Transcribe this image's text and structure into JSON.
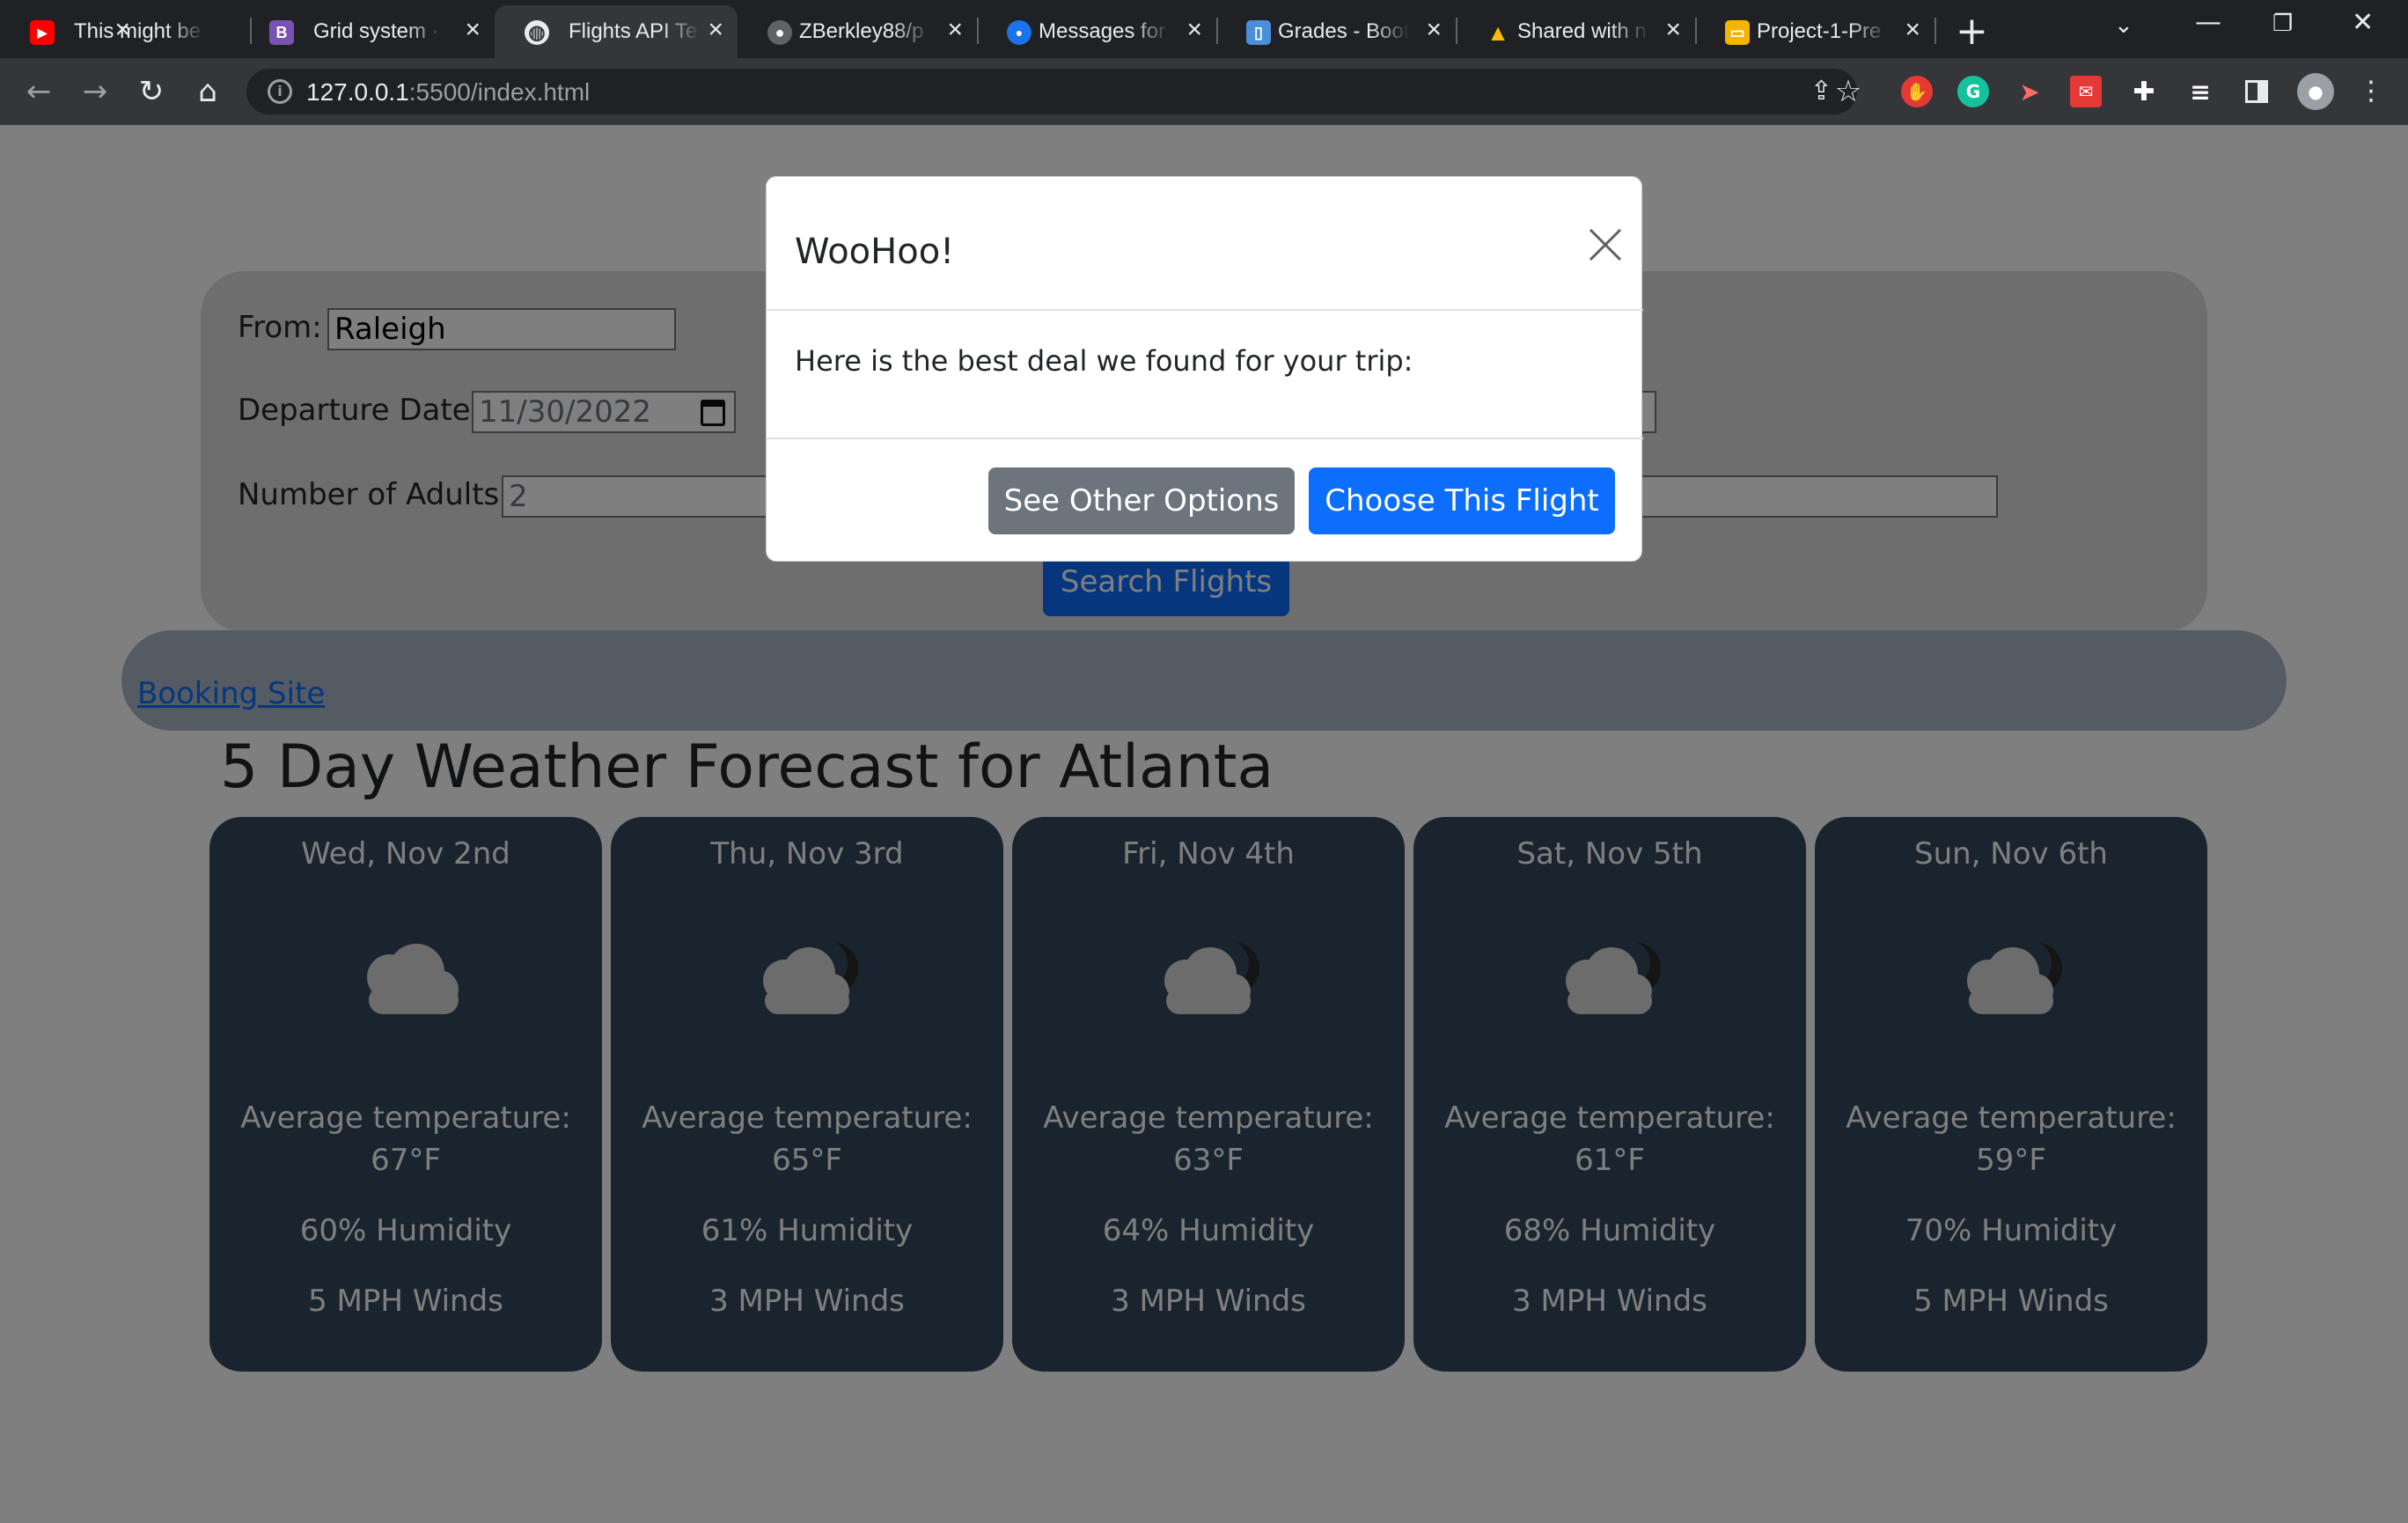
{
  "browser": {
    "tabs": [
      {
        "title": "This might be",
        "favicon": "youtube-icon",
        "color": "#ff0000",
        "glyph": "▶"
      },
      {
        "title": "Grid system ·",
        "favicon": "bootstrap-icon",
        "color": "#7952b3",
        "glyph": "B"
      },
      {
        "title": "Flights API Te",
        "favicon": "globe-icon",
        "color": "#35363a",
        "glyph": "◍"
      },
      {
        "title": "ZBerkley88/p",
        "favicon": "github-icon",
        "color": "#202124",
        "glyph": "●"
      },
      {
        "title": "Messages for",
        "favicon": "messages-icon",
        "color": "#1a73e8",
        "glyph": "●"
      },
      {
        "title": "Grades - Boot",
        "favicon": "grades-icon",
        "color": "#4a90d9",
        "glyph": "▯"
      },
      {
        "title": "Shared with n",
        "favicon": "drive-icon",
        "color": "#1fa463",
        "glyph": "▲"
      },
      {
        "title": "Project-1-Pre",
        "favicon": "slides-icon",
        "color": "#f4b400",
        "glyph": "▭"
      }
    ],
    "url_host": "127.0.0.1",
    "url_rest": ":5500/index.html"
  },
  "page": {
    "title_fragment": "",
    "form": {
      "from_label": "From:",
      "from_value": "Raleigh",
      "departure_label": "Departure Date:",
      "departure_value": "11/30/2022",
      "adults_label": "Number of Adults:",
      "adults_value": "2",
      "search_button": "Search Flights"
    },
    "booking_link": "Booking Site",
    "forecast_title": "5 Day Weather Forecast for Atlanta",
    "forecast": [
      {
        "date": "Wed, Nov 2nd",
        "temp_label": "Average temperature:",
        "temp": "67°F",
        "humidity": "60% Humidity",
        "wind": "5 MPH Winds",
        "icon": "cloud-icon"
      },
      {
        "date": "Thu, Nov 3rd",
        "temp_label": "Average temperature:",
        "temp": "65°F",
        "humidity": "61% Humidity",
        "wind": "3 MPH Winds",
        "icon": "cloudy-night-icon"
      },
      {
        "date": "Fri, Nov 4th",
        "temp_label": "Average temperature:",
        "temp": "63°F",
        "humidity": "64% Humidity",
        "wind": "3 MPH Winds",
        "icon": "cloudy-night-icon"
      },
      {
        "date": "Sat, Nov 5th",
        "temp_label": "Average temperature:",
        "temp": "61°F",
        "humidity": "68% Humidity",
        "wind": "3 MPH Winds",
        "icon": "cloudy-night-icon"
      },
      {
        "date": "Sun, Nov 6th",
        "temp_label": "Average temperature:",
        "temp": "59°F",
        "humidity": "70% Humidity",
        "wind": "5 MPH Winds",
        "icon": "cloudy-night-icon"
      }
    ]
  },
  "modal": {
    "title": "WooHoo!",
    "body": "Here is the best deal we found for your trip:",
    "secondary_button": "See Other Options",
    "primary_button": "Choose This Flight"
  },
  "colors": {
    "primary": "#0d6efd",
    "secondary": "#6c757d",
    "card": "#34495e",
    "chrome_dark": "#202124"
  }
}
